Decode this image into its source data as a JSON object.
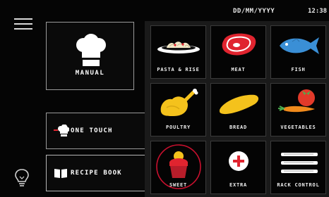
{
  "header": {
    "date": "DD/MM/YYYY",
    "time": "12:38",
    "menu_icon": "hamburger-menu-icon"
  },
  "left": {
    "manual": {
      "label": "MANUAL",
      "icon": "chef-hat-icon"
    },
    "one_touch": {
      "label": "ONE TOUCH",
      "icon": "chef-hat-icon"
    },
    "recipe_book": {
      "label": "RECIPE BOOK",
      "icon": "book-icon"
    },
    "light_icon": "lightbulb-icon"
  },
  "categories": [
    {
      "label": "PASTA & RISE",
      "icon": "pasta-icon"
    },
    {
      "label": "MEAT",
      "icon": "steak-icon"
    },
    {
      "label": "FISH",
      "icon": "fish-icon"
    },
    {
      "label": "POULTRY",
      "icon": "chicken-icon"
    },
    {
      "label": "BREAD",
      "icon": "bread-icon"
    },
    {
      "label": "VEGETABLES",
      "icon": "vegetables-icon"
    },
    {
      "label": "SWEET",
      "icon": "cupcake-icon",
      "selected": true
    },
    {
      "label": "EXTRA",
      "icon": "plus-circle-icon"
    },
    {
      "label": "RACK CONTROL",
      "icon": "oven-racks-icon"
    }
  ],
  "colors": {
    "background": "#050505",
    "border": "#9a9a9a",
    "meat_red": "#e0242f",
    "fish_blue": "#3a8fd6",
    "food_yellow": "#f4c21c",
    "tomato_red": "#e23a2a",
    "carrot_orange": "#f08a1c",
    "selection_ring": "#c8102e",
    "white": "#ffffff"
  }
}
